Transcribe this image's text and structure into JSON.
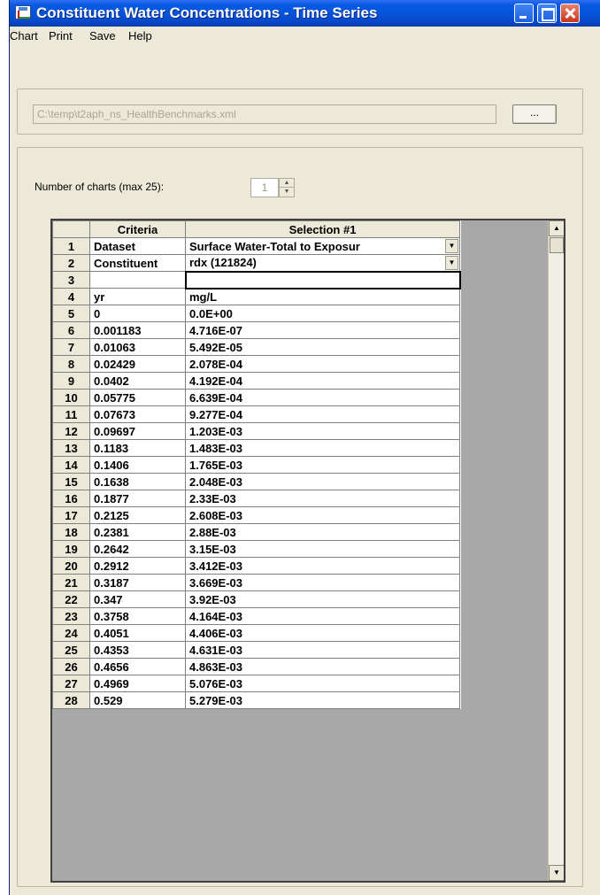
{
  "window": {
    "title": "Constituent Water Concentrations - Time Series"
  },
  "menu": {
    "items": [
      "Chart",
      "Print",
      "Save",
      "Help"
    ]
  },
  "file": {
    "path": "C:\\temp\\t2aph_ns_HealthBenchmarks.xml",
    "browse_label": "..."
  },
  "charts": {
    "label": "Number of charts (max 25):",
    "value": "1"
  },
  "grid": {
    "header": [
      "",
      "Criteria",
      "Selection #1"
    ],
    "rows": [
      {
        "num": "1",
        "criteria": "Dataset",
        "value": "Surface Water-Total to Exposur"
      },
      {
        "num": "2",
        "criteria": "Constituent",
        "value": "rdx (121824)"
      },
      {
        "num": "3",
        "criteria": "",
        "value": ""
      },
      {
        "num": "4",
        "criteria": "yr",
        "value": "mg/L"
      },
      {
        "num": "5",
        "criteria": "0",
        "value": "0.0E+00"
      },
      {
        "num": "6",
        "criteria": "0.001183",
        "value": "4.716E-07"
      },
      {
        "num": "7",
        "criteria": "0.01063",
        "value": "5.492E-05"
      },
      {
        "num": "8",
        "criteria": "0.02429",
        "value": "2.078E-04"
      },
      {
        "num": "9",
        "criteria": "0.0402",
        "value": "4.192E-04"
      },
      {
        "num": "10",
        "criteria": "0.05775",
        "value": "6.639E-04"
      },
      {
        "num": "11",
        "criteria": "0.07673",
        "value": "9.277E-04"
      },
      {
        "num": "12",
        "criteria": "0.09697",
        "value": "1.203E-03"
      },
      {
        "num": "13",
        "criteria": "0.1183",
        "value": "1.483E-03"
      },
      {
        "num": "14",
        "criteria": "0.1406",
        "value": "1.765E-03"
      },
      {
        "num": "15",
        "criteria": "0.1638",
        "value": "2.048E-03"
      },
      {
        "num": "16",
        "criteria": "0.1877",
        "value": "2.33E-03"
      },
      {
        "num": "17",
        "criteria": "0.2125",
        "value": "2.608E-03"
      },
      {
        "num": "18",
        "criteria": "0.2381",
        "value": "2.88E-03"
      },
      {
        "num": "19",
        "criteria": "0.2642",
        "value": "3.15E-03"
      },
      {
        "num": "20",
        "criteria": "0.2912",
        "value": "3.412E-03"
      },
      {
        "num": "21",
        "criteria": "0.3187",
        "value": "3.669E-03"
      },
      {
        "num": "22",
        "criteria": "0.347",
        "value": "3.92E-03"
      },
      {
        "num": "23",
        "criteria": "0.3758",
        "value": "4.164E-03"
      },
      {
        "num": "24",
        "criteria": "0.4051",
        "value": "4.406E-03"
      },
      {
        "num": "25",
        "criteria": "0.4353",
        "value": "4.631E-03"
      },
      {
        "num": "26",
        "criteria": "0.4656",
        "value": "4.863E-03"
      },
      {
        "num": "27",
        "criteria": "0.4969",
        "value": "5.076E-03"
      },
      {
        "num": "28",
        "criteria": "0.529",
        "value": "5.279E-03"
      }
    ]
  }
}
